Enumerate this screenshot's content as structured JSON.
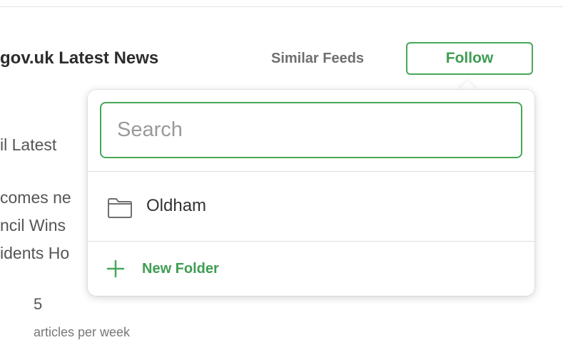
{
  "header": {
    "feed_title": "gov.uk Latest News",
    "similar_feeds_label": "Similar Feeds",
    "follow_label": "Follow"
  },
  "background": {
    "line1": "il Latest",
    "line2": "comes ne",
    "line3": "ncil Wins",
    "line4": "idents Ho",
    "count": "5",
    "count_label": "articles per week"
  },
  "dropdown": {
    "search_placeholder": "Search",
    "folders": [
      {
        "label": "Oldham",
        "icon": "folder-icon"
      }
    ],
    "new_folder_label": "New Folder",
    "new_folder_icon": "plus-icon"
  },
  "colors": {
    "accent": "#46a758",
    "accent_text": "#3e9d52"
  }
}
